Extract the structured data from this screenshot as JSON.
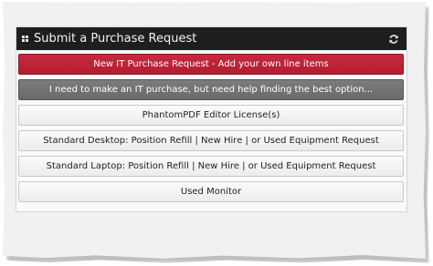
{
  "panel": {
    "title": "Submit a Purchase Request",
    "title_icon": "grid-icon",
    "action_icon": "refresh-icon"
  },
  "buttons": [
    {
      "label": "New IT Purchase Request - Add your own line items",
      "style": "primary-red",
      "color": "#b8233a"
    },
    {
      "label": "I need to make an IT purchase, but need help finding the best option...",
      "style": "dark-gray",
      "color": "#727272"
    },
    {
      "label": "PhantomPDF Editor License(s)",
      "style": "default"
    },
    {
      "label": "Standard Desktop: Position Refill | New Hire | or Used Equipment Request",
      "style": "default"
    },
    {
      "label": "Standard Laptop: Position Refill | New Hire | or Used Equipment Request",
      "style": "default"
    },
    {
      "label": "Used Monitor",
      "style": "default"
    }
  ]
}
